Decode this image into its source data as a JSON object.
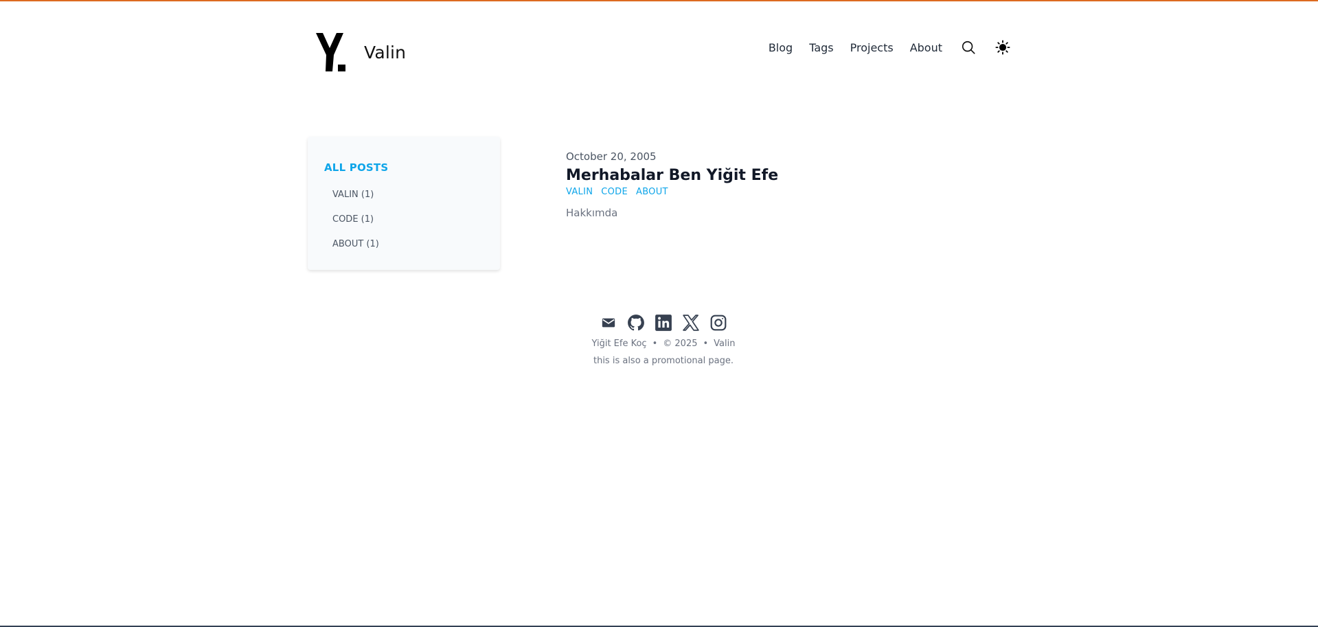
{
  "header": {
    "logo_icon": "y-logo-icon",
    "site_title": "Valin",
    "nav": [
      "Blog",
      "Tags",
      "Projects",
      "About"
    ],
    "search_icon": "search-icon",
    "theme_icon": "sun-icon"
  },
  "sidebar": {
    "all_posts_label": "ALL POSTS",
    "tags": [
      "VALIN (1)",
      "CODE (1)",
      "ABOUT (1)"
    ]
  },
  "post": {
    "date": "October 20, 2005",
    "title": "Merhabalar Ben Yiğit Efe",
    "tags": [
      "VALIN",
      "CODE",
      "ABOUT"
    ],
    "summary": "Hakkımda"
  },
  "footer": {
    "social_icons": [
      "mail-icon",
      "github-icon",
      "linkedin-icon",
      "x-icon",
      "instagram-icon"
    ],
    "author": "Yiğit Efe Koç",
    "copyright": "© 2025",
    "site": "Valin",
    "note": "this is also a promotional page."
  },
  "colors": {
    "accent": "#0ea5e9",
    "top_border": "#dd6b20",
    "sidebar_bg": "#f8fafc"
  }
}
